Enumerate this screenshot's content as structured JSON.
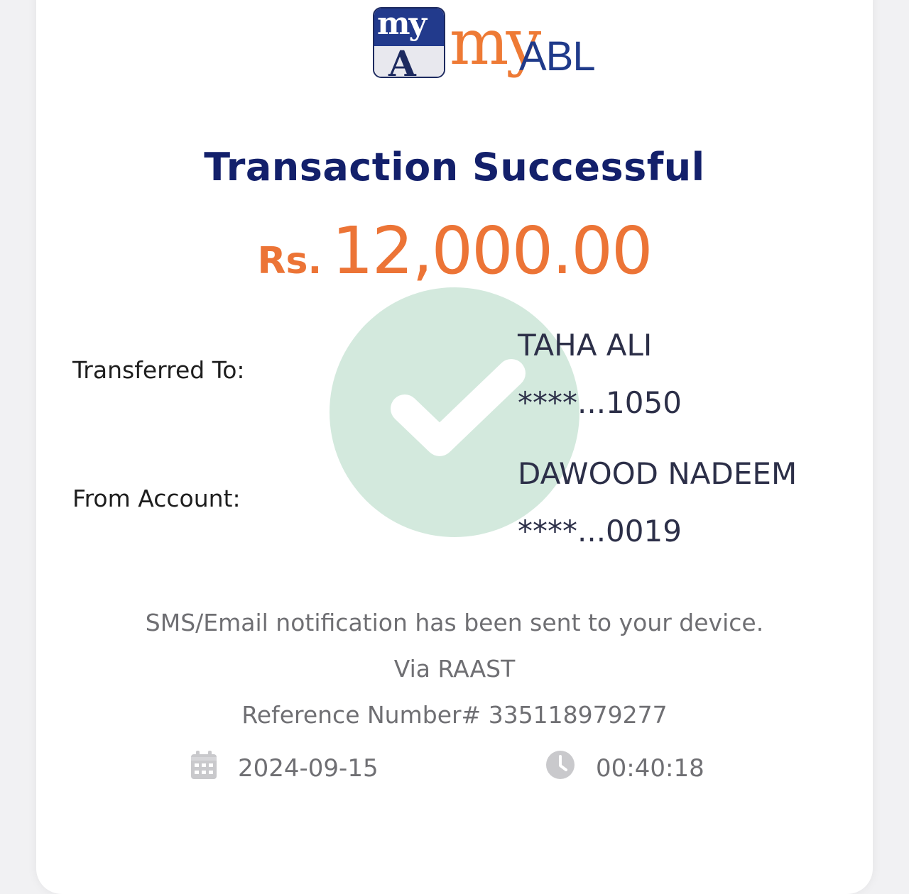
{
  "logo": {
    "badge_text": "my",
    "badge_mark": "A",
    "wordmark_my": "my",
    "wordmark_abl": "ABL"
  },
  "status": {
    "title": "Transaction Successful",
    "icon": "check-icon"
  },
  "amount": {
    "currency": "Rs.",
    "value": "12,000.00"
  },
  "transfer": {
    "to_label": "Transferred To:",
    "to_name": "TAHA ALI",
    "to_account": "****...1050",
    "from_label": "From Account:",
    "from_name": "DAWOOD NADEEM",
    "from_account": "****...0019"
  },
  "info": {
    "notification": "SMS/Email notification has been sent to your device.",
    "channel": "Via RAAST",
    "reference": "Reference Number# 335118979277"
  },
  "meta": {
    "date": "2024-09-15",
    "time": "00:40:18",
    "date_icon": "calendar-icon",
    "time_icon": "clock-icon"
  },
  "colors": {
    "title": "#13206b",
    "amount": "#ec7436",
    "check_bg": "#d3e9dd",
    "muted_text": "#6f6f73"
  }
}
